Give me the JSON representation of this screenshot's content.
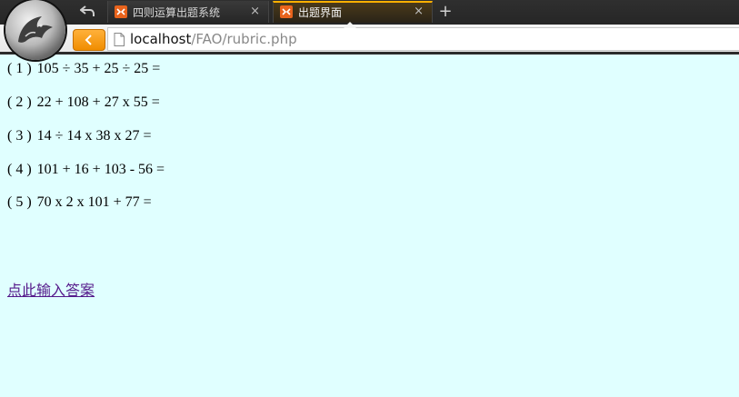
{
  "browser": {
    "tabs": [
      {
        "title": "四则运算出题系统",
        "active": false
      },
      {
        "title": "出题界面",
        "active": true
      }
    ],
    "url_host": "localhost",
    "url_path": "/FAO/rubric.php",
    "tab_close_glyph": "×",
    "new_tab_glyph": "+",
    "accent_color": "#f39200"
  },
  "questions": [
    {
      "number": "( 1 )",
      "expression": "105 ÷ 35 + 25 ÷ 25 ="
    },
    {
      "number": "( 2 )",
      "expression": "22 + 108 + 27 x 55 ="
    },
    {
      "number": "( 3 )",
      "expression": "14 ÷ 14 x 38 x 27 ="
    },
    {
      "number": "( 4 )",
      "expression": "101 + 16 + 103 - 56 ="
    },
    {
      "number": "( 5 )",
      "expression": "70 x 2 x 101 + 77 ="
    }
  ],
  "answer_link": "点此输入答案",
  "page_background": "#e0ffff"
}
